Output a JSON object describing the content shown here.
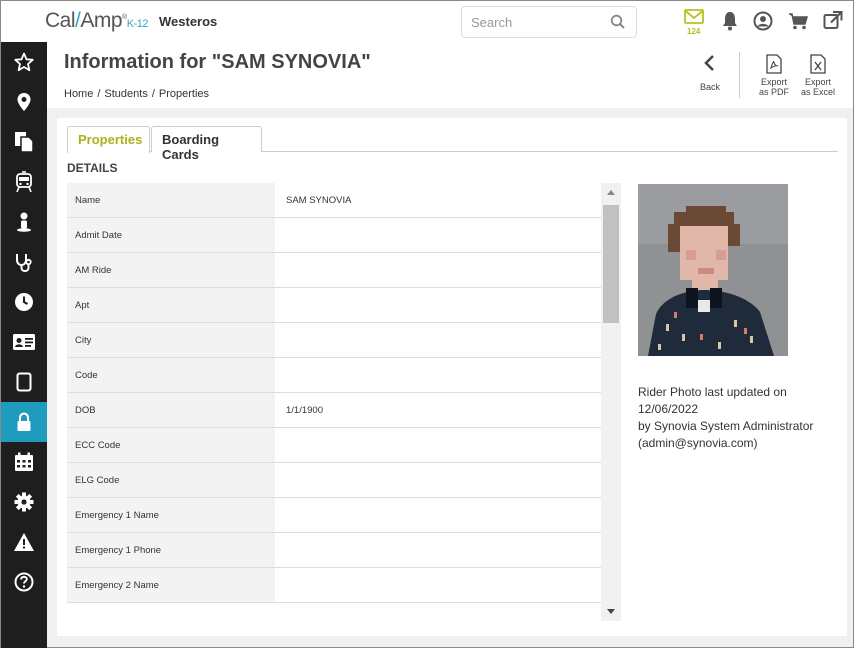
{
  "app": {
    "logo_cal": "Cal",
    "logo_slash": "/",
    "logo_amp": "Amp",
    "logo_tm": "®",
    "logo_k12": "K-12",
    "site_name": "Westeros"
  },
  "search": {
    "placeholder": "Search"
  },
  "topbar": {
    "mail_count": "124",
    "colors": {
      "accent": "#b8c21f",
      "icon": "#555555"
    }
  },
  "sidebar": {
    "items": [
      {
        "icon": "star-icon"
      },
      {
        "icon": "map-pin-icon"
      },
      {
        "icon": "documents-icon"
      },
      {
        "icon": "bus-icon"
      },
      {
        "icon": "person-icon"
      },
      {
        "icon": "stethoscope-icon"
      },
      {
        "icon": "clock-icon"
      },
      {
        "icon": "id-card-icon"
      },
      {
        "icon": "tablet-icon"
      },
      {
        "icon": "lock-icon",
        "active": true
      },
      {
        "icon": "calendar-icon"
      },
      {
        "icon": "gear-icon"
      },
      {
        "icon": "warning-icon"
      },
      {
        "icon": "help-icon"
      }
    ],
    "active_color": "#1f9bbd"
  },
  "header": {
    "title": "Information for \"SAM SYNOVIA\"",
    "breadcrumb": [
      "Home",
      "Students",
      "Properties"
    ],
    "breadcrumb_sep": "/",
    "back_label": "Back",
    "export_pdf_label_1": "Export",
    "export_pdf_label_2": "as PDF",
    "export_excel_label_1": "Export",
    "export_excel_label_2": "as Excel"
  },
  "tabs": [
    {
      "label": "Properties",
      "active": true
    },
    {
      "label": "Boarding Cards",
      "active": false
    }
  ],
  "details_label": "DETAILS",
  "properties": [
    {
      "key": "Name",
      "value": "SAM SYNOVIA"
    },
    {
      "key": "Admit Date",
      "value": ""
    },
    {
      "key": "AM Ride",
      "value": ""
    },
    {
      "key": "Apt",
      "value": ""
    },
    {
      "key": "City",
      "value": ""
    },
    {
      "key": "Code",
      "value": ""
    },
    {
      "key": "DOB",
      "value": "1/1/1900"
    },
    {
      "key": "ECC Code",
      "value": ""
    },
    {
      "key": "ELG Code",
      "value": ""
    },
    {
      "key": "Emergency 1 Name",
      "value": ""
    },
    {
      "key": "Emergency 1 Phone",
      "value": ""
    },
    {
      "key": "Emergency 2 Name",
      "value": ""
    }
  ],
  "photo": {
    "caption_line1": "Rider Photo last updated on 12/06/2022",
    "caption_line2": "by Synovia System Administrator",
    "caption_line3": "(admin@synovia.com)"
  }
}
